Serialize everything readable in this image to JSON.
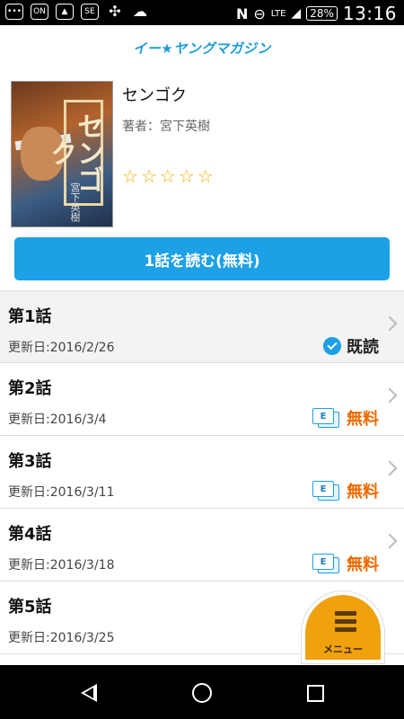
{
  "status_bar": {
    "network": "LTE",
    "battery": "28%",
    "time": "13:16",
    "icons": [
      "message-icon",
      "on-icon",
      "image-icon",
      "se-icon",
      "pinwheel-icon",
      "cloud-icon",
      "nfc-icon",
      "minus-icon",
      "signal-icon",
      "battery-icon"
    ]
  },
  "header": {
    "logo": "イー★ヤングマガジン"
  },
  "book": {
    "title": "センゴク",
    "author_label": "著者：宮下英樹",
    "cover_title": "センゴク",
    "cover_author": "宮下英樹",
    "rating": 0,
    "max_rating": 5,
    "stars": [
      "☆",
      "☆",
      "☆",
      "☆",
      "☆"
    ]
  },
  "read_button": {
    "label": "1話を読む(無料)"
  },
  "episodes": [
    {
      "title": "第1話",
      "date": "更新日:2016/2/26",
      "status": "既読",
      "status_type": "read"
    },
    {
      "title": "第2話",
      "date": "更新日:2016/3/4",
      "status": "無料",
      "status_type": "free"
    },
    {
      "title": "第3話",
      "date": "更新日:2016/3/11",
      "status": "無料",
      "status_type": "free"
    },
    {
      "title": "第4話",
      "date": "更新日:2016/3/18",
      "status": "無料",
      "status_type": "free"
    },
    {
      "title": "第5話",
      "date": "更新日:2016/3/25",
      "status": "",
      "status_type": ""
    }
  ],
  "ticket_label": "E",
  "menu_button": {
    "label": "メニュー"
  },
  "colors": {
    "accent": "#1da0e6",
    "free": "#ee6a00",
    "menu": "#f0a10e",
    "star": "#f2b200"
  }
}
